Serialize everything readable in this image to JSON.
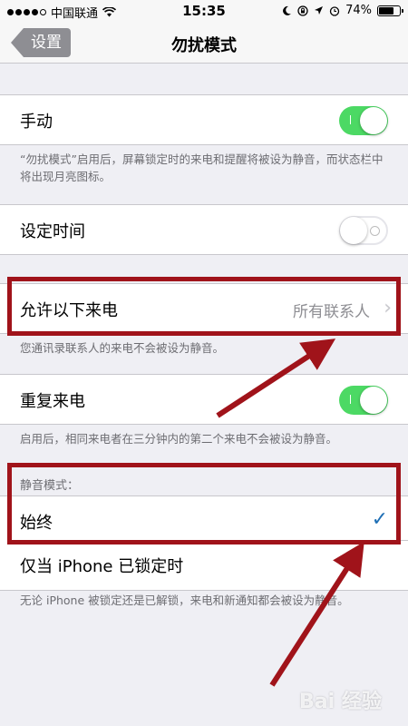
{
  "status_bar": {
    "carrier": "中国联通",
    "time": "15:35",
    "battery": "74%",
    "battery_level": 0.74
  },
  "nav": {
    "back_label": "设置",
    "title": "勿扰模式"
  },
  "manual": {
    "label": "手动",
    "toggle_on": true
  },
  "manual_footer": "“勿扰模式”启用后，屏幕锁定时的来电和提醒将被设为静音，而状态栏中将出现月亮图标。",
  "scheduled": {
    "label": "设定时间",
    "toggle_on": false
  },
  "allow_calls": {
    "label": "允许以下来电",
    "value": "所有联系人"
  },
  "allow_calls_footer": "您通讯录联系人的来电不会被设为静音。",
  "repeated_calls": {
    "label": "重复来电",
    "toggle_on": true
  },
  "repeated_calls_footer": "启用后，相同来电者在三分钟内的第二个来电不会被设为静音。",
  "silence": {
    "header": "静音模式：",
    "always_label": "始终",
    "locked_label": "仅当 iPhone 已锁定时"
  },
  "silence_footer": "无论 iPhone 被锁定还是已解锁，来电和新通知都会被设为静音。",
  "watermark": "Bai 经验",
  "colors": {
    "toggle_on": "#4cd964",
    "annotation": "#a0131a",
    "checkmark": "#1f6fb5"
  }
}
